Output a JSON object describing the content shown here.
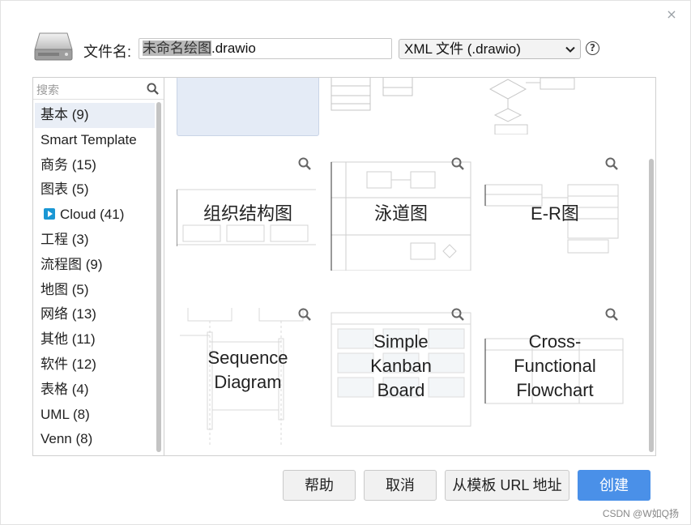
{
  "dialog": {
    "close_glyph": "×",
    "filename_label": "文件名:",
    "filename_selected": "未命名绘图",
    "filename_extension": ".drawio",
    "format_value": "XML 文件 (.drawio)",
    "help_glyph": "?"
  },
  "search": {
    "placeholder": "搜索"
  },
  "categories": [
    {
      "label": "基本 (9)"
    },
    {
      "label": "Smart Template"
    },
    {
      "label": "商务 (15)"
    },
    {
      "label": "图表 (5)"
    },
    {
      "label": "Cloud (41)"
    },
    {
      "label": "工程 (3)"
    },
    {
      "label": "流程图 (9)"
    },
    {
      "label": "地图 (5)"
    },
    {
      "label": "网络 (13)"
    },
    {
      "label": "其他 (11)"
    },
    {
      "label": "软件 (12)"
    },
    {
      "label": "表格 (4)"
    },
    {
      "label": "UML (8)"
    },
    {
      "label": "Venn (8)"
    }
  ],
  "templates": {
    "org": {
      "line1": "组织结构图"
    },
    "swimlane": {
      "line1": "泳道图"
    },
    "er": {
      "line1": "E-R图"
    },
    "sequence": {
      "line1": "Sequence",
      "line2": "Diagram"
    },
    "kanban": {
      "line1": "Simple",
      "line2": "Kanban",
      "line3": "Board"
    },
    "crossfunc": {
      "line1": "Cross-",
      "line2": "Functional",
      "line3": "Flowchart"
    }
  },
  "buttons": {
    "help": "帮助",
    "cancel": "取消",
    "from_url": "从模板 URL 地址",
    "create": "创建"
  },
  "watermark": "CSDN @W如Q扬",
  "colors": {
    "primary": "#4a90e8",
    "selected_bg": "#e9eef6"
  }
}
